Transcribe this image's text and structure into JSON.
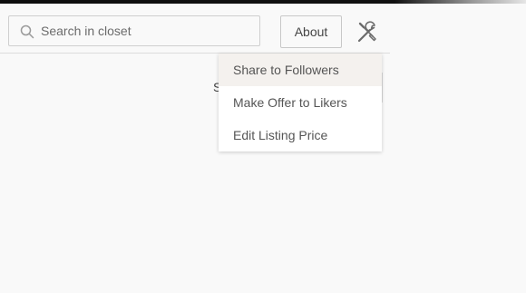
{
  "header": {
    "search": {
      "placeholder": "Search in closet",
      "value": "",
      "icon": "search-icon"
    },
    "about_label": "About",
    "tools_icon": "wrench-screwdriver-icon"
  },
  "background": {
    "partial_text": "S"
  },
  "menu": {
    "items": [
      {
        "label": "Share to Followers",
        "highlighted": true
      },
      {
        "label": "Make Offer to Likers",
        "highlighted": false
      },
      {
        "label": "Edit Listing Price",
        "highlighted": false
      }
    ]
  }
}
